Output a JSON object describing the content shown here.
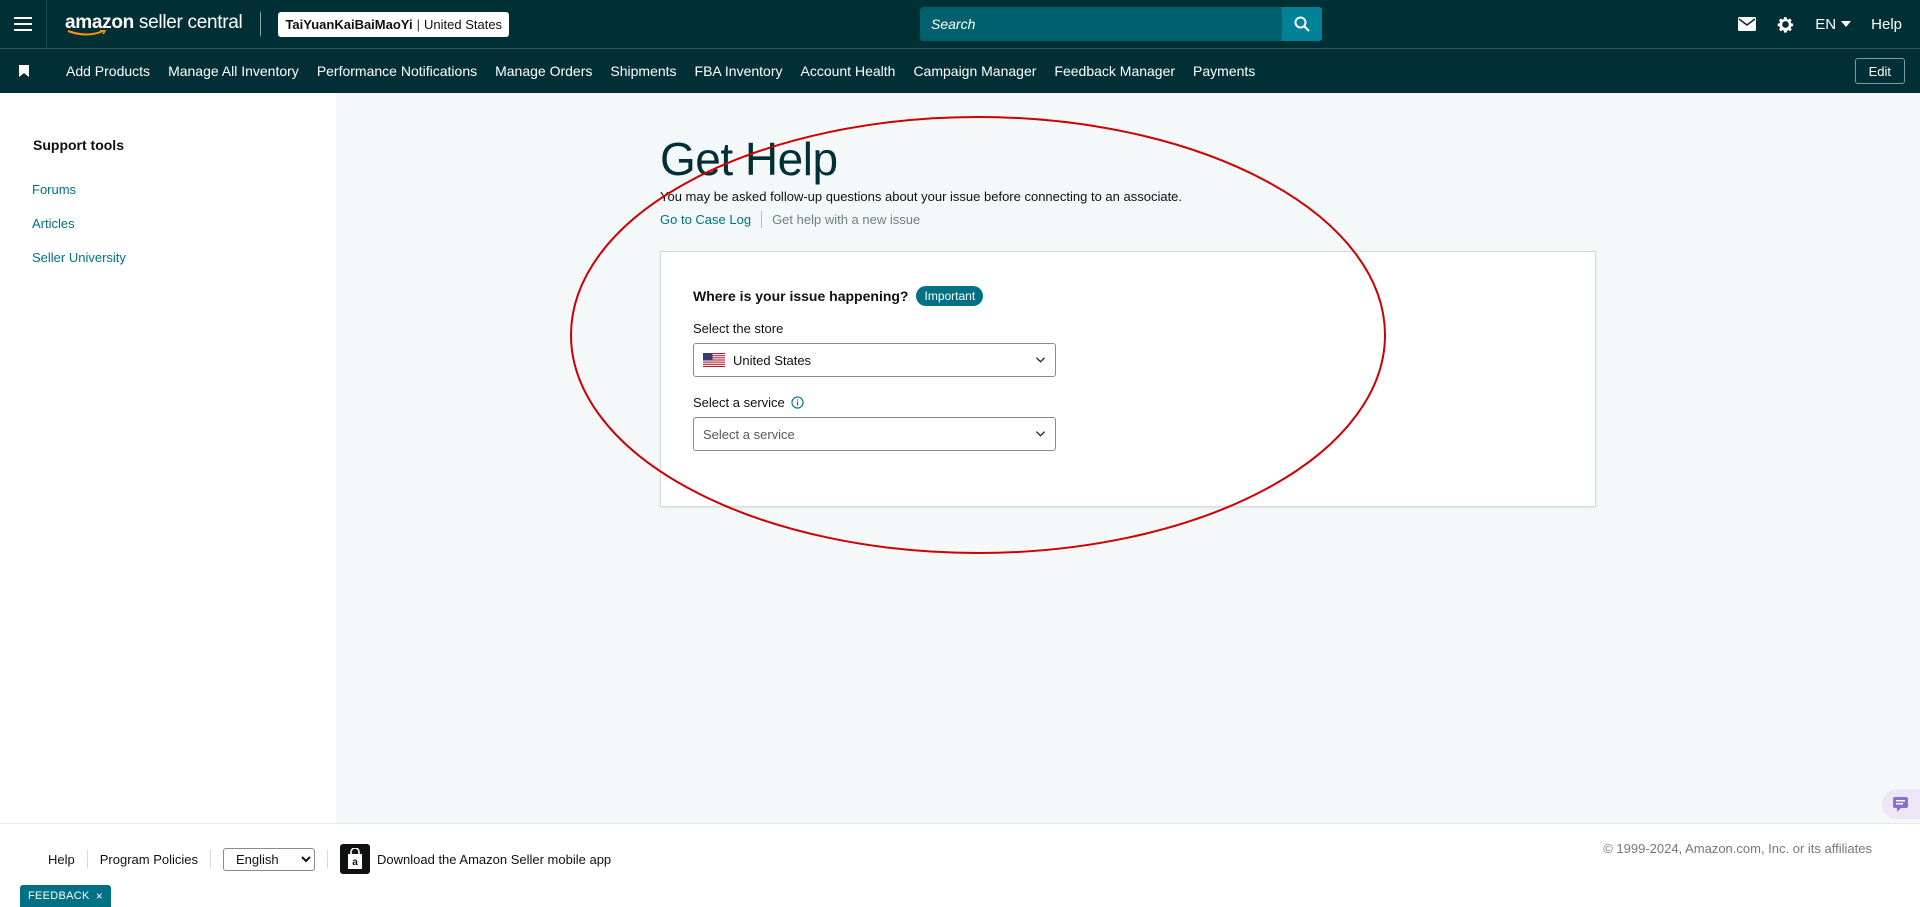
{
  "header": {
    "logo_text_bold": "amazon",
    "logo_text": " seller central",
    "account_name": "TaiYuanKaiBaiMaoYi",
    "account_sep": "|",
    "account_marketplace": "United States",
    "search_placeholder": "Search",
    "language": "EN",
    "help_label": "Help"
  },
  "nav": {
    "items": [
      {
        "label": "Add Products"
      },
      {
        "label": "Manage All Inventory"
      },
      {
        "label": "Performance Notifications"
      },
      {
        "label": "Manage Orders"
      },
      {
        "label": "Shipments"
      },
      {
        "label": "FBA Inventory"
      },
      {
        "label": "Account Health"
      },
      {
        "label": "Campaign Manager"
      },
      {
        "label": "Feedback Manager"
      },
      {
        "label": "Payments"
      }
    ],
    "edit_label": "Edit"
  },
  "sidebar": {
    "title": "Support tools",
    "links": [
      {
        "label": "Forums"
      },
      {
        "label": "Articles"
      },
      {
        "label": "Seller University"
      }
    ]
  },
  "main": {
    "title": "Get Help",
    "subtitle": "You may be asked follow-up questions about your issue before connecting to an associate.",
    "case_log_link": "Go to Case Log",
    "new_issue_link": "Get help with a new issue",
    "card": {
      "question": "Where is your issue happening?",
      "badge": "Important",
      "store_label": "Select the store",
      "store_value": "United States",
      "service_label": "Select a service",
      "service_placeholder": "Select a service"
    }
  },
  "footer": {
    "help": "Help",
    "program_policies": "Program Policies",
    "language_selected": "English",
    "app_text": "Download the Amazon Seller mobile app",
    "copyright": "© 1999-2024, Amazon.com, Inc. or its affiliates",
    "feedback_label": "FEEDBACK",
    "feedback_close": "×"
  },
  "colors": {
    "header_bg": "#002f36",
    "accent_teal": "#007185",
    "search_bg": "#00606b",
    "annotation_red": "#cc0000"
  }
}
